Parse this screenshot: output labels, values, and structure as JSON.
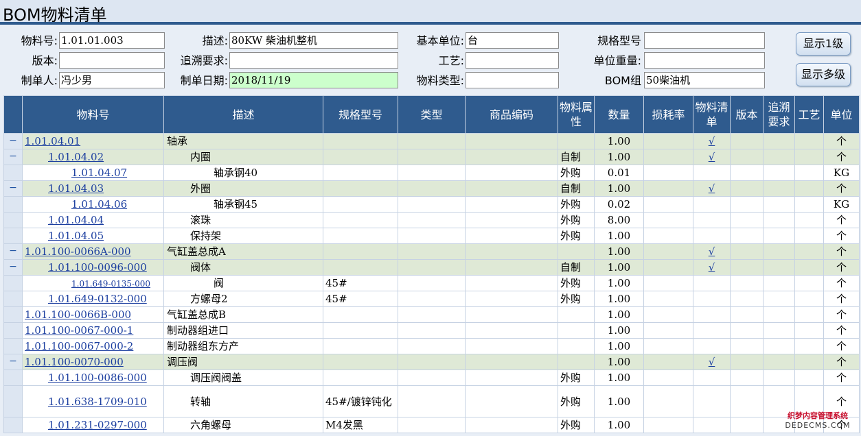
{
  "title": "BOM物料清单",
  "form": {
    "material_no_label": "物料号:",
    "material_no": "1.01.01.003",
    "desc_label": "描述:",
    "desc": "80KW 柴油机整机",
    "base_unit_label": "基本单位:",
    "base_unit": "台",
    "spec_label": "规格型号",
    "spec": "",
    "version_label": "版本:",
    "version": "",
    "trace_label": "追溯要求:",
    "trace": "",
    "process_label": "工艺:",
    "process": "",
    "unit_weight_label": "单位重量:",
    "unit_weight": "",
    "creator_label": "制单人:",
    "creator": "冯少男",
    "date_label": "制单日期:",
    "date": "2018/11/19",
    "mat_type_label": "物料类型:",
    "mat_type": "",
    "bom_group_label": "BOM组",
    "bom_group": "50柴油机"
  },
  "buttons": {
    "level1": "显示1级",
    "multi": "显示多级"
  },
  "columns": [
    "",
    "物料号",
    "描述",
    "规格型号",
    "类型",
    "商品编码",
    "物料属性",
    "数量",
    "损耗率",
    "物料清单",
    "版本",
    "追溯要求",
    "工艺",
    "单位"
  ],
  "rows": [
    {
      "t": "−",
      "code": "1.01.04.01",
      "desc": "轴承",
      "spec": "",
      "attr": "",
      "qty": "1.00",
      "bom": "√",
      "unit": "个"
    },
    {
      "t": "−",
      "code": "1.01.04.02",
      "desc": "内圈",
      "spec": "",
      "attr": "自制",
      "qty": "1.00",
      "bom": "√",
      "unit": "个"
    },
    {
      "t": "",
      "code": "1.01.04.07",
      "desc": "轴承钢40",
      "spec": "",
      "attr": "外购",
      "qty": "0.01",
      "bom": "",
      "unit": "KG"
    },
    {
      "t": "−",
      "code": "1.01.04.03",
      "desc": "外圈",
      "spec": "",
      "attr": "自制",
      "qty": "1.00",
      "bom": "√",
      "unit": "个"
    },
    {
      "t": "",
      "code": "1.01.04.06",
      "desc": "轴承钢45",
      "spec": "",
      "attr": "外购",
      "qty": "0.02",
      "bom": "",
      "unit": "KG"
    },
    {
      "t": "",
      "code": "1.01.04.04",
      "desc": "滚珠",
      "spec": "",
      "attr": "外购",
      "qty": "8.00",
      "bom": "",
      "unit": "个"
    },
    {
      "t": "",
      "code": "1.01.04.05",
      "desc": "保持架",
      "spec": "",
      "attr": "外购",
      "qty": "1.00",
      "bom": "",
      "unit": "个"
    },
    {
      "t": "−",
      "code": "1.01.100-0066A-000",
      "desc": "气缸盖总成A",
      "spec": "",
      "attr": "",
      "qty": "1.00",
      "bom": "√",
      "unit": "个"
    },
    {
      "t": "−",
      "code": "1.01.100-0096-000",
      "desc": "阀体",
      "spec": "",
      "attr": "自制",
      "qty": "1.00",
      "bom": "√",
      "unit": "个"
    },
    {
      "t": "",
      "code": "1.01.649-0135-000",
      "desc": "阀",
      "spec": "45#",
      "attr": "外购",
      "qty": "1.00",
      "bom": "",
      "unit": "个"
    },
    {
      "t": "",
      "code": "1.01.649-0132-000",
      "desc": "方螺母2",
      "spec": "45#",
      "attr": "外购",
      "qty": "1.00",
      "bom": "",
      "unit": "个"
    },
    {
      "t": "",
      "code": "1.01.100-0066B-000",
      "desc": "气缸盖总成B",
      "spec": "",
      "attr": "",
      "qty": "1.00",
      "bom": "",
      "unit": "个"
    },
    {
      "t": "",
      "code": "1.01.100-0067-000-1",
      "desc": "制动器组进口",
      "spec": "",
      "attr": "",
      "qty": "1.00",
      "bom": "",
      "unit": "个"
    },
    {
      "t": "",
      "code": "1.01.100-0067-000-2",
      "desc": "制动器组东方产",
      "spec": "",
      "attr": "",
      "qty": "1.00",
      "bom": "",
      "unit": "个"
    },
    {
      "t": "−",
      "code": "1.01.100-0070-000",
      "desc": "调压阀",
      "spec": "",
      "attr": "",
      "qty": "1.00",
      "bom": "√",
      "unit": "个"
    },
    {
      "t": "",
      "code": "1.01.100-0086-000",
      "desc": "调压阀阀盖",
      "spec": "",
      "attr": "外购",
      "qty": "1.00",
      "bom": "",
      "unit": "个"
    },
    {
      "t": "",
      "code": "1.01.638-1709-010",
      "desc": "转轴",
      "spec": "45#/镀锌钝化",
      "attr": "外购",
      "qty": "1.00",
      "bom": "",
      "unit": "个"
    },
    {
      "t": "",
      "code": "1.01.231-0297-000",
      "desc": "六角螺母",
      "spec": "M4发黑",
      "attr": "外购",
      "qty": "1.00",
      "bom": "",
      "unit": "个"
    }
  ],
  "watermark": {
    "line1": "织梦内容管理系统",
    "line2": "DEDECMS.COM"
  }
}
